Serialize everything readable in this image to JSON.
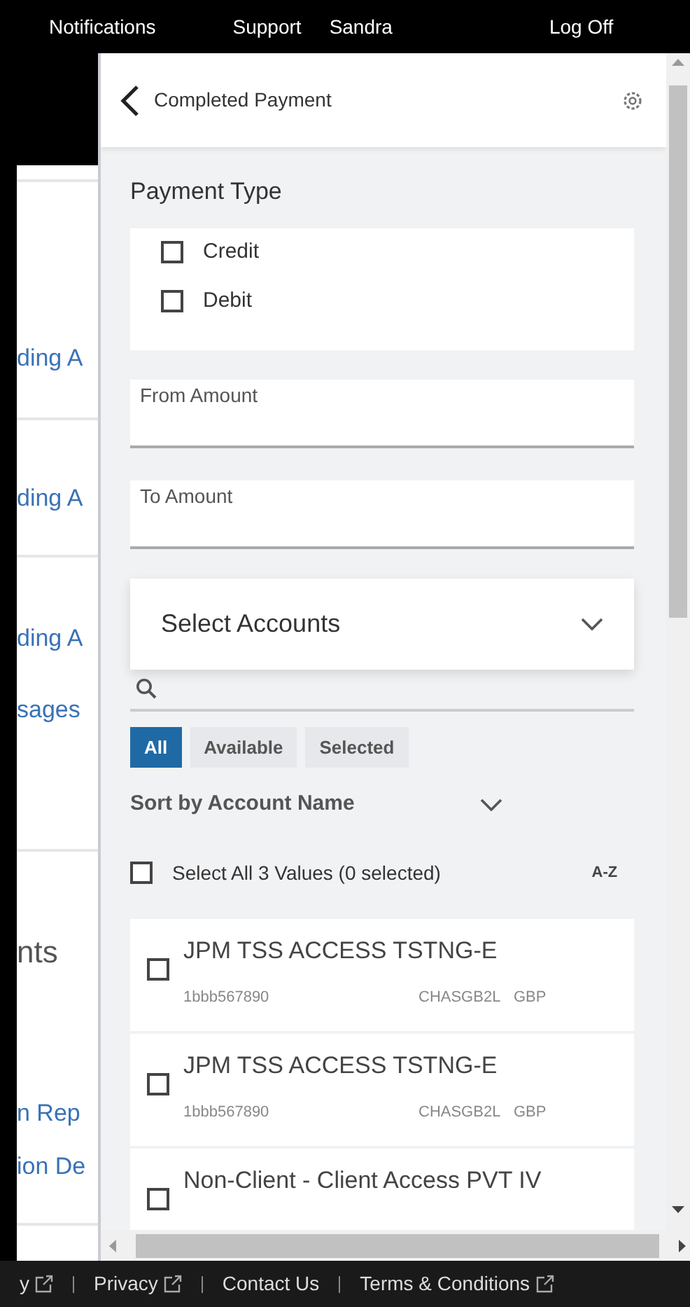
{
  "top_nav": [
    {
      "label": "Notifications"
    },
    {
      "label": "Support"
    },
    {
      "label": "Sandra"
    },
    {
      "label": "Log Off"
    }
  ],
  "background_page": [
    {
      "kind": "link",
      "text": "ding A"
    },
    {
      "kind": "link",
      "text": "ding A"
    },
    {
      "kind": "link",
      "text": "ding A"
    },
    {
      "kind": "link",
      "text": "sages"
    },
    {
      "kind": "heading",
      "text": "nts"
    },
    {
      "kind": "link",
      "text": "n Rep"
    },
    {
      "kind": "link",
      "text": "ion De"
    }
  ],
  "panel": {
    "title": "Completed Payment",
    "payment_type": {
      "label": "Payment Type",
      "options": [
        {
          "label": "Credit",
          "checked": false
        },
        {
          "label": "Debit",
          "checked": false
        }
      ]
    },
    "amount_fields": [
      {
        "label": "From Amount"
      },
      {
        "label": "To Amount"
      }
    ],
    "accounts_dropdown": {
      "label": "Select Accounts"
    },
    "filters": [
      {
        "label": "All",
        "selected": true
      },
      {
        "label": "Available",
        "selected": false
      },
      {
        "label": "Selected",
        "selected": false
      }
    ],
    "sort": {
      "label": "Sort by Account Name"
    },
    "select_all": {
      "label": "Select All 3 Values (0 selected)",
      "checked": false
    },
    "sort_order": "A-Z",
    "accounts": [
      {
        "name": "JPM TSS ACCESS TSTNG-E",
        "number": "1bbb567890",
        "bic": "CHASGB2L",
        "currency": "GBP",
        "checked": false
      },
      {
        "name": "JPM TSS ACCESS TSTNG-E",
        "number": "1bbb567890",
        "bic": "CHASGB2L",
        "currency": "GBP",
        "checked": false
      },
      {
        "name": "Non-Client - Client Access PVT IV",
        "checked": false
      }
    ]
  },
  "footer": [
    {
      "label": "y",
      "external": true
    },
    {
      "label": "Privacy",
      "external": true
    },
    {
      "label": "Contact Us",
      "external": false
    },
    {
      "label": "Terms & Conditions",
      "external": true
    }
  ]
}
